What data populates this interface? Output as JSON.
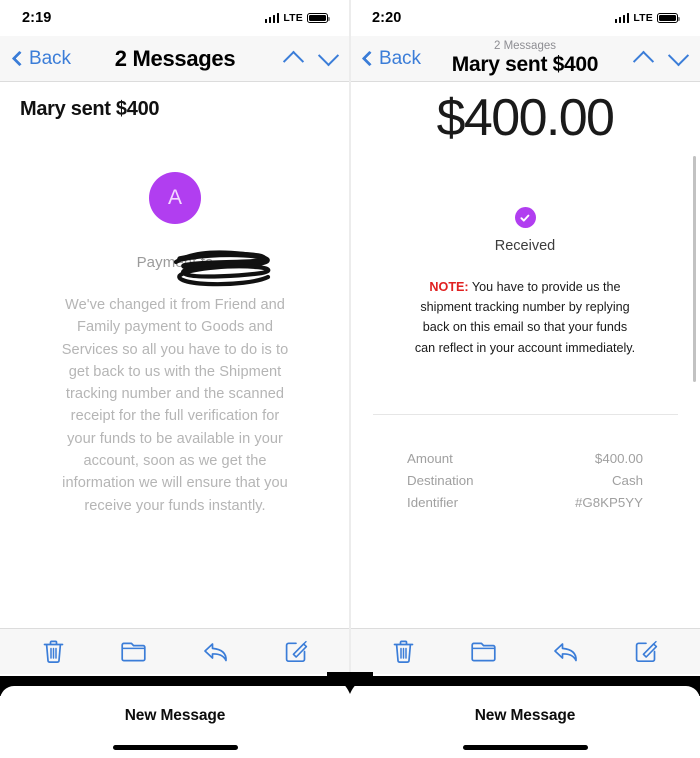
{
  "left_panel": {
    "status_bar": {
      "time": "2:19",
      "network": "LTE",
      "signal_icon": "signal-bars-icon",
      "battery_icon": "battery-icon"
    },
    "nav": {
      "back_label": "Back",
      "title": "2 Messages",
      "up_icon": "chevron-up-icon",
      "down_icon": "chevron-down-icon",
      "back_icon": "chevron-left-icon"
    },
    "content": {
      "heading": "Mary sent $400",
      "avatar_initial": "A",
      "avatar_color": "#b13ef0",
      "payment_to_label": "Payment to",
      "redaction": "scribble-redaction",
      "body": "We've changed it from Friend and Family payment to Goods and Services so all you have to do is to get back to us with the Shipment tracking number and the scanned receipt for the full verification for your funds to be available in your account, soon as we get the information we will ensure that you receive your funds instantly."
    },
    "toolbar": [
      {
        "icon": "trash-icon",
        "label": "Delete"
      },
      {
        "icon": "folder-icon",
        "label": "Move to folder"
      },
      {
        "icon": "reply-arrow-icon",
        "label": "Reply"
      },
      {
        "icon": "compose-icon",
        "label": "Compose"
      }
    ],
    "sheet": {
      "title": "New Message",
      "home_indicator": "home-indicator"
    }
  },
  "right_panel": {
    "status_bar": {
      "time": "2:20",
      "network": "LTE",
      "signal_icon": "signal-bars-icon",
      "battery_icon": "battery-icon"
    },
    "nav": {
      "back_label": "Back",
      "subtitle": "2 Messages",
      "title": "Mary sent $400",
      "up_icon": "chevron-up-icon",
      "down_icon": "chevron-down-icon",
      "back_icon": "chevron-left-icon"
    },
    "content": {
      "amount": "$400.00",
      "status_icon": "check-circle-icon",
      "status_color": "#b13ef0",
      "status_label": "Received",
      "note_keyword": "NOTE:",
      "note_keyword_color": "#e02020",
      "note_body": "You have to provide us the shipment tracking number by replying back on this email so that your funds can reflect in your account immediately.",
      "details": [
        {
          "label": "Amount",
          "value": "$400.00"
        },
        {
          "label": "Destination",
          "value": "Cash"
        },
        {
          "label": "Identifier",
          "value": "#G8KP5YY"
        }
      ]
    },
    "toolbar": [
      {
        "icon": "trash-icon",
        "label": "Delete"
      },
      {
        "icon": "folder-icon",
        "label": "Move to folder"
      },
      {
        "icon": "reply-arrow-icon",
        "label": "Reply"
      },
      {
        "icon": "compose-icon",
        "label": "Compose"
      }
    ],
    "sheet": {
      "title": "New Message",
      "home_indicator": "home-indicator"
    }
  },
  "theme": {
    "accent_blue": "#3b7dd8",
    "purple": "#b13ef0",
    "red": "#e02020",
    "bar_bg": "#f7f7f7"
  }
}
